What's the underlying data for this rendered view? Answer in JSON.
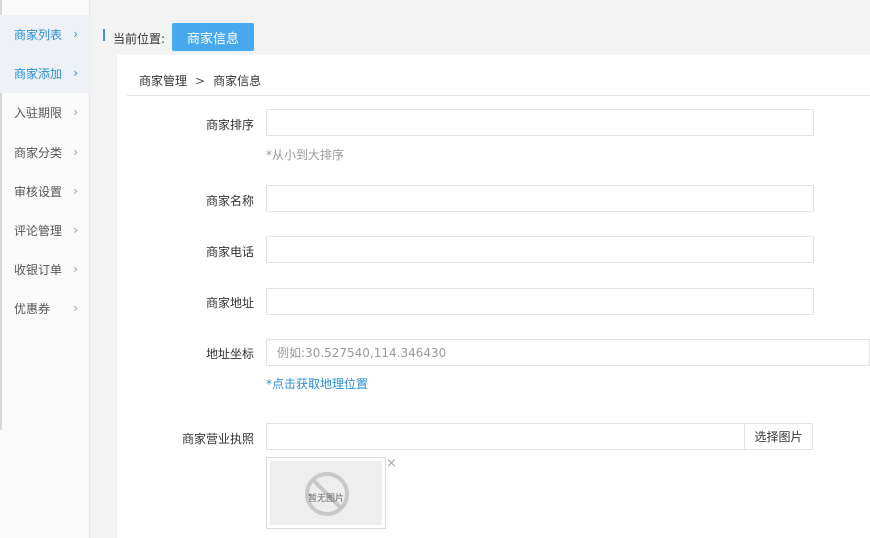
{
  "sidebar": {
    "items": [
      {
        "label": "商家列表",
        "state": "active"
      },
      {
        "label": "商家添加",
        "state": "active"
      },
      {
        "label": "入驻期限",
        "state": "normal"
      },
      {
        "label": "商家分类",
        "state": "normal"
      },
      {
        "label": "审核设置",
        "state": "normal"
      },
      {
        "label": "评论管理",
        "state": "normal"
      },
      {
        "label": "收银订单",
        "state": "normal"
      },
      {
        "label": "优惠券",
        "state": "normal"
      }
    ],
    "chevron": "›"
  },
  "location": {
    "label": "当前位置:",
    "button": "商家信息"
  },
  "breadcrumb": {
    "parent": "商家管理",
    "separator": ">",
    "current": "商家信息"
  },
  "form": {
    "sort": {
      "label": "商家排序",
      "value": "",
      "hint": "*从小到大排序"
    },
    "name": {
      "label": "商家名称",
      "value": ""
    },
    "phone": {
      "label": "商家电话",
      "value": ""
    },
    "address": {
      "label": "商家地址",
      "value": ""
    },
    "coords": {
      "label": "地址坐标",
      "value": "",
      "placeholder": "例如:30.527540,114.346430",
      "link": "*点击获取地理位置"
    },
    "license": {
      "label": "商家营业执照",
      "value": "",
      "pick_button": "选择图片",
      "no_image_text": "暂无图片",
      "remove_icon": "×"
    }
  },
  "colors": {
    "accent": "#49a9ee",
    "link": "#2a8fd4"
  }
}
